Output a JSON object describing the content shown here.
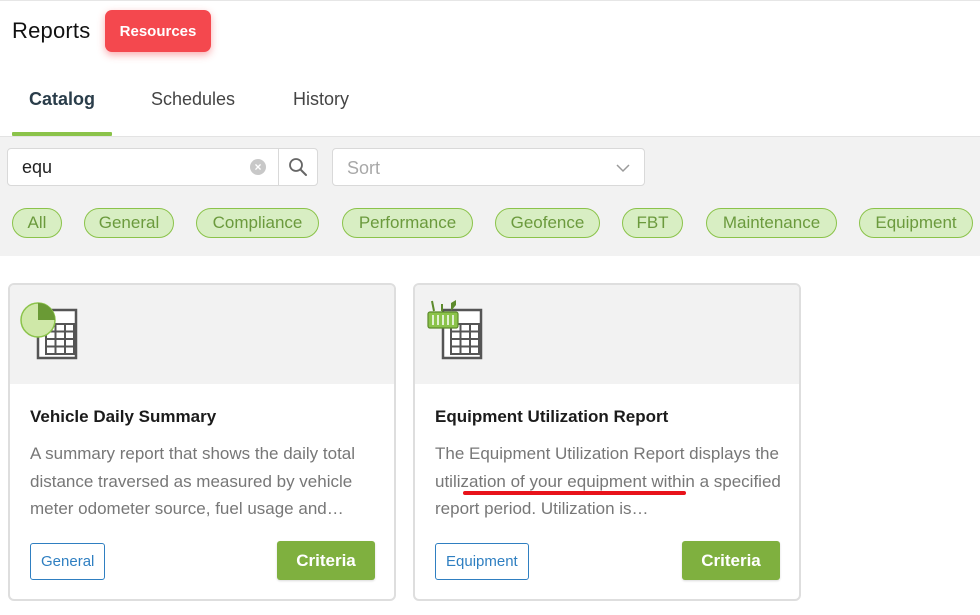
{
  "header": {
    "title": "Reports",
    "resources_label": "Resources"
  },
  "tabs": [
    {
      "label": "Catalog",
      "active": true
    },
    {
      "label": "Schedules",
      "active": false
    },
    {
      "label": "History",
      "active": false
    }
  ],
  "search": {
    "value": "equ",
    "clear_icon": "clear-circle-icon",
    "search_icon": "search-icon"
  },
  "sort": {
    "placeholder": "Sort",
    "icon": "chevron-down-icon"
  },
  "chips": [
    "All",
    "General",
    "Compliance",
    "Performance",
    "Geofence",
    "FBT",
    "Maintenance",
    "Equipment"
  ],
  "cards": [
    {
      "title": "Vehicle Daily Summary",
      "description": "A summary report that shows the daily total distance traversed as measured by vehicle meter odometer source, fuel usage and…",
      "tag": "General",
      "action": "Criteria",
      "icon": "pie-chart-spreadsheet-icon"
    },
    {
      "title": "Equipment Utilization Report",
      "description": "The Equipment Utilization Report displays the utilization of your equipment within a specified report period. Utilization is…",
      "tag": "Equipment",
      "action": "Criteria",
      "icon": "equipment-spreadsheet-icon"
    }
  ],
  "colors": {
    "resources": "#f4484e",
    "accent_green": "#8bc34a",
    "criteria_green": "#7fb03f",
    "tag_blue": "#2f7fc1",
    "annotation_red": "#e8121a"
  }
}
